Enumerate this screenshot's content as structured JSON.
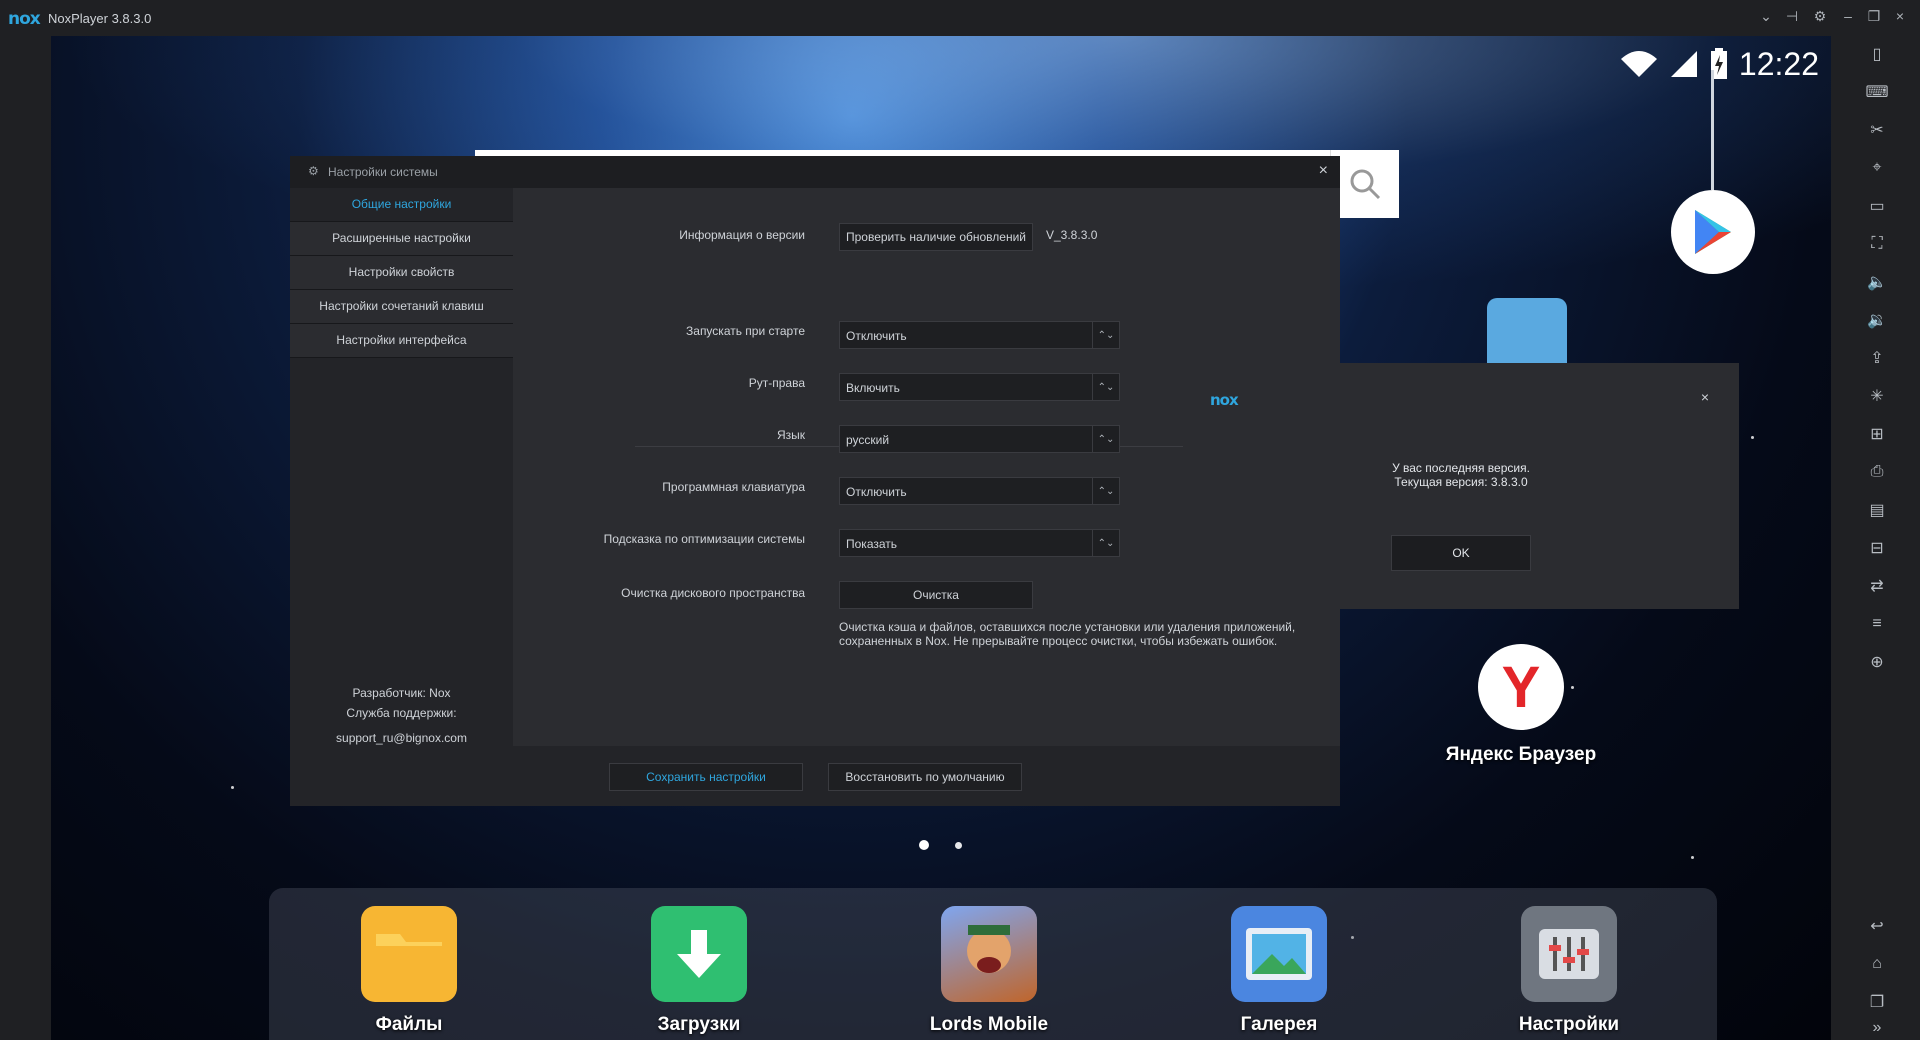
{
  "window": {
    "logo": "nox",
    "title": "NoxPlayer 3.8.3.0",
    "controls": [
      "chevron-down-icon",
      "pin-icon",
      "gear-icon",
      "minimize-icon",
      "restore-icon",
      "close-icon"
    ]
  },
  "android": {
    "clock": "12:22",
    "page_dots": 2,
    "google_play_label": "",
    "yandex_label": "Яндекс Браузер",
    "dock": [
      {
        "label": "Файлы",
        "icon": "folder-icon",
        "color": "#f7b633"
      },
      {
        "label": "Загрузки",
        "icon": "download-icon",
        "color": "#2fbf71"
      },
      {
        "label": "Lords Mobile",
        "icon": "game-icon",
        "color": "#5a7ad8"
      },
      {
        "label": "Галерея",
        "icon": "gallery-icon",
        "color": "#4b86e0"
      },
      {
        "label": "Настройки",
        "icon": "settings-sliders-icon",
        "color": "#6f7680"
      }
    ]
  },
  "settings": {
    "title": "Настройки системы",
    "nav": [
      {
        "label": "Общие настройки",
        "active": true
      },
      {
        "label": "Расширенные настройки",
        "active": false
      },
      {
        "label": "Настройки свойств",
        "active": false
      },
      {
        "label": "Настройки сочетаний клавиш",
        "active": false
      },
      {
        "label": "Настройки интерфейса",
        "active": false
      }
    ],
    "developer": "Разработчик: Nox",
    "support_label": "Служба поддержки:",
    "support_email": "support_ru@bignox.com",
    "version_label": "Информация о версии",
    "check_updates": "Проверить наличие обновлений",
    "version": "V_3.8.3.0",
    "rows": [
      {
        "label": "Запускать при старте",
        "value": "Отключить"
      },
      {
        "label": "Рут-права",
        "value": "Включить"
      },
      {
        "label": "Язык",
        "value": "русский"
      },
      {
        "label": "Программная клавиатура",
        "value": "Отключить"
      },
      {
        "label": "Подсказка по оптимизации системы",
        "value": "Показать"
      }
    ],
    "cleanup_label": "Очистка дискового пространства",
    "cleanup_button": "Очистка",
    "cleanup_note_1": "Очистка кэша и файлов, оставшихся после установки или удаления приложений,",
    "cleanup_note_2": "сохраненных в Nox. Не прерывайте процесс очистки, чтобы избежать ошибок.",
    "save": "Сохранить настройки",
    "restore": "Восстановить по умолчанию",
    "accent": "#2fa6de"
  },
  "popup": {
    "logo": "nox",
    "line1": "У вас последняя версия.",
    "line2": "Текущая версия: 3.8.3.0",
    "ok": "OK"
  },
  "right_toolbar": [
    "phone-rotate-icon",
    "keyboard-icon",
    "scissors-icon",
    "location-icon",
    "screen-icon",
    "fullscreen-icon",
    "volume-up-icon",
    "volume-down-icon",
    "apk-install-icon",
    "shake-icon",
    "multi-instance-icon",
    "screenshot-icon",
    "record-icon",
    "macro-icon",
    "sync-icon",
    "menu-icon",
    "add-window-icon",
    "back-icon",
    "home-icon",
    "recent-apps-icon",
    "more-icon"
  ]
}
